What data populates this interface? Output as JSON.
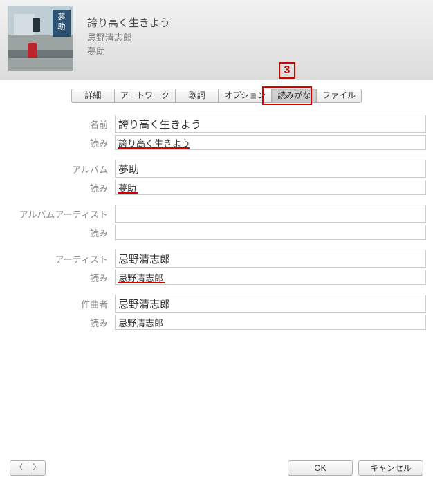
{
  "callout": "3",
  "header": {
    "title": "誇り高く生きよう",
    "artist": "忌野清志郎",
    "album": "夢助",
    "art_banner_chars": [
      "夢",
      "助"
    ]
  },
  "tabs": {
    "items": [
      "詳細",
      "アートワーク",
      "歌詞",
      "オプション",
      "読みがな",
      "ファイル"
    ],
    "active_index": 4
  },
  "form": {
    "name": {
      "label": "名前",
      "value": "誇り高く生きよう"
    },
    "name_yomi": {
      "label": "読み",
      "value": "誇り高く生きよう",
      "underline": true,
      "underline_width": 104
    },
    "album": {
      "label": "アルバム",
      "value": "夢助"
    },
    "album_yomi": {
      "label": "読み",
      "value": "夢助",
      "underline": true,
      "underline_width": 30
    },
    "album_artist": {
      "label": "アルバムアーティスト",
      "value": ""
    },
    "album_artist_yomi": {
      "label": "読み",
      "value": ""
    },
    "artist": {
      "label": "アーティスト",
      "value": "忌野清志郎"
    },
    "artist_yomi": {
      "label": "読み",
      "value": "忌野清志郎",
      "underline": true,
      "underline_width": 68
    },
    "composer": {
      "label": "作曲者",
      "value": "忌野清志郎"
    },
    "composer_yomi": {
      "label": "読み",
      "value": "忌野清志郎"
    }
  },
  "footer": {
    "prev": "〈",
    "next": "〉",
    "ok": "OK",
    "cancel": "キャンセル"
  }
}
